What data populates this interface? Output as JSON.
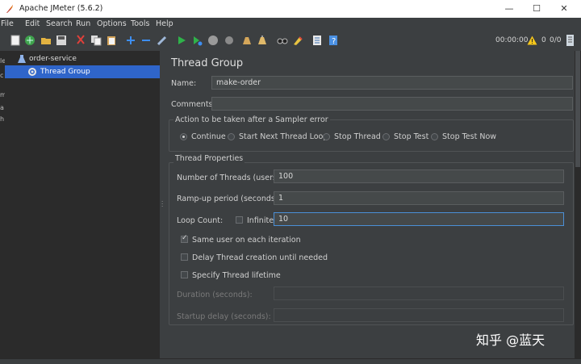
{
  "window": {
    "title": "Apache JMeter (5.6.2)",
    "minimize_glyph": "—",
    "maximize_glyph": "☐",
    "close_glyph": "✕"
  },
  "menu": {
    "items": [
      {
        "label": "File"
      },
      {
        "label": "Edit"
      },
      {
        "label": "Search"
      },
      {
        "label": "Run"
      },
      {
        "label": "Options"
      },
      {
        "label": "Tools"
      },
      {
        "label": "Help"
      }
    ]
  },
  "toolbar": {
    "icons": [
      "new-icon",
      "templates-icon",
      "open-icon",
      "save-icon",
      "cut-icon",
      "copy-icon",
      "paste-icon",
      "expand-icon",
      "collapse-icon",
      "toggle-icon",
      "start-icon",
      "start-no-pause-icon",
      "stop-icon",
      "shutdown-icon",
      "clear-icon",
      "clear-all-icon",
      "search-binoculars-icon",
      "reset-search-icon",
      "function-helper-icon",
      "help-icon"
    ],
    "accent_colors": {
      "add": "#3d8ef2",
      "start": "#2fb24a",
      "stop": "#9a9a9a"
    }
  },
  "status": {
    "time": "00:00:00",
    "warnings": "0",
    "threads": "0/0"
  },
  "left_strip": {
    "chars": [
      "le",
      "c",
      "m",
      "a",
      "h",
      "",
      "",
      "",
      ""
    ]
  },
  "tree": {
    "root": "order-service",
    "child": "Thread Group",
    "selection_color": "#2f65ca"
  },
  "panel": {
    "title": "Thread Group",
    "name_label": "Name:",
    "name_value": "make-order",
    "comments_label": "Comments:",
    "comments_value": "",
    "sampler_error": {
      "legend": "Action to be taken after a Sampler error",
      "options": [
        "Continue",
        "Start Next Thread Loop",
        "Stop Thread",
        "Stop Test",
        "Stop Test Now"
      ],
      "selected": "Continue"
    },
    "thread_properties": {
      "legend": "Thread Properties",
      "threads_label": "Number of Threads (users):",
      "threads_value": "100",
      "rampup_label": "Ramp-up period (seconds):",
      "rampup_value": "1",
      "loop_label": "Loop Count:",
      "infinite_label": "Infinite",
      "infinite_checked": false,
      "loop_value": "10",
      "same_user_label": "Same user on each iteration",
      "same_user_checked": true,
      "delay_label": "Delay Thread creation until needed",
      "delay_checked": false,
      "lifetime_label": "Specify Thread lifetime",
      "lifetime_checked": false,
      "duration_label": "Duration (seconds):",
      "duration_value": "",
      "startup_label": "Startup delay (seconds):",
      "startup_value": ""
    }
  },
  "watermark": "知乎 @蓝天"
}
